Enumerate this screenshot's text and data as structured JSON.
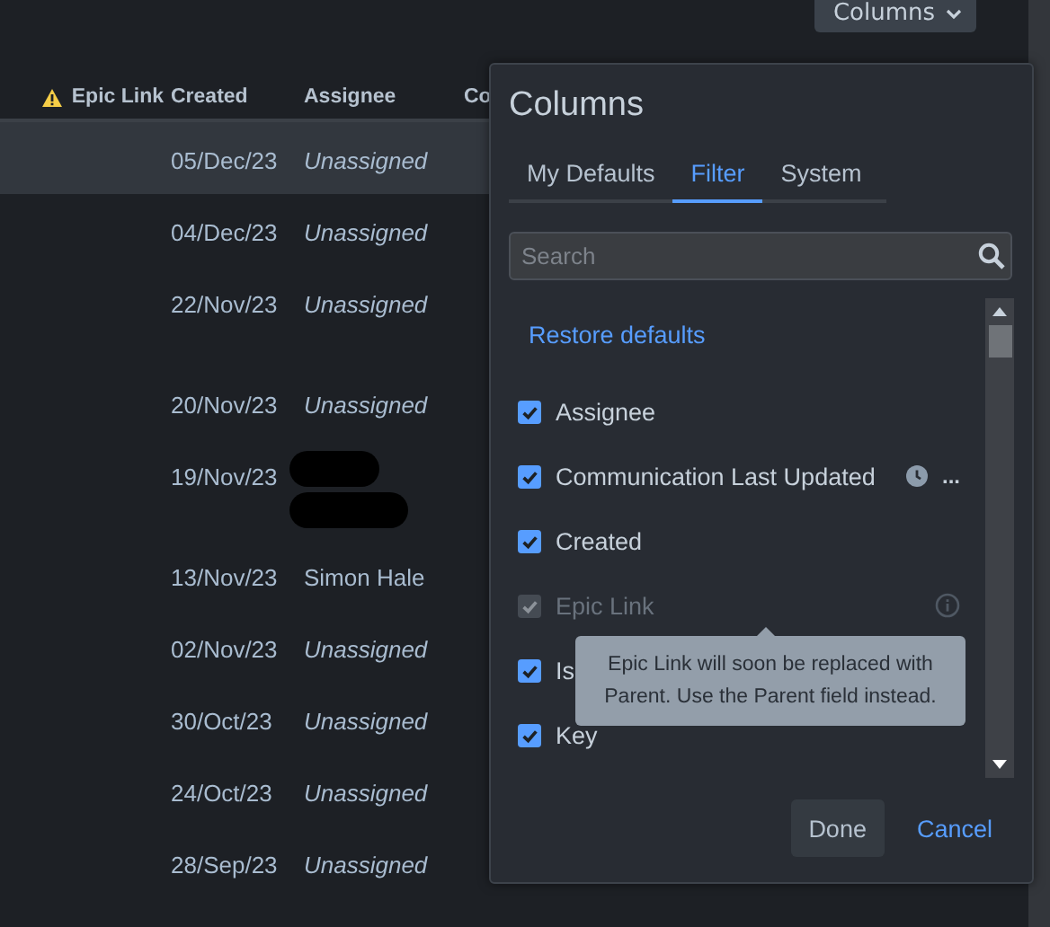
{
  "toolbar": {
    "columns_button": "Columns"
  },
  "table": {
    "columns": [
      {
        "label": "Epic Link",
        "warning": true
      },
      {
        "label": "Created"
      },
      {
        "label": "Assignee"
      },
      {
        "label": "Co"
      }
    ],
    "rows": [
      {
        "created": "05/Dec/23",
        "assignee": "Unassigned",
        "unassigned": true,
        "redacted": false,
        "tall": false,
        "selected": true
      },
      {
        "created": "04/Dec/23",
        "assignee": "Unassigned",
        "unassigned": true,
        "redacted": false,
        "tall": false,
        "selected": false
      },
      {
        "created": "22/Nov/23",
        "assignee": "Unassigned",
        "unassigned": true,
        "redacted": false,
        "tall": true,
        "selected": false
      },
      {
        "created": "20/Nov/23",
        "assignee": "Unassigned",
        "unassigned": true,
        "redacted": false,
        "tall": false,
        "selected": false
      },
      {
        "created": "19/Nov/23",
        "redacted": true,
        "tall": true,
        "selected": false
      },
      {
        "created": "13/Nov/23",
        "assignee": "Simon Hale",
        "unassigned": false,
        "redacted": false,
        "tall": false,
        "selected": false
      },
      {
        "created": "02/Nov/23",
        "assignee": "Unassigned",
        "unassigned": true,
        "redacted": false,
        "tall": false,
        "selected": false
      },
      {
        "created": "30/Oct/23",
        "assignee": "Unassigned",
        "unassigned": true,
        "redacted": false,
        "tall": false,
        "selected": false
      },
      {
        "created": "24/Oct/23",
        "assignee": "Unassigned",
        "unassigned": true,
        "redacted": false,
        "tall": false,
        "selected": false
      },
      {
        "created": "28/Sep/23",
        "assignee": "Unassigned",
        "unassigned": true,
        "redacted": false,
        "tall": false,
        "selected": false
      }
    ]
  },
  "columns_dialog": {
    "title": "Columns",
    "tabs": [
      {
        "label": "My Defaults",
        "selected": false
      },
      {
        "label": "Filter",
        "selected": true
      },
      {
        "label": "System",
        "selected": false
      }
    ],
    "search": {
      "placeholder": "Search"
    },
    "restore_link": "Restore defaults",
    "items": [
      {
        "kind": "plain",
        "label": "Assignee",
        "checked": true,
        "disabled": false
      },
      {
        "kind": "timestamp",
        "label": "Communication Last Updated",
        "checked": true,
        "disabled": false,
        "suffix": "..."
      },
      {
        "kind": "plain",
        "label": "Created",
        "checked": true,
        "disabled": false
      },
      {
        "kind": "info",
        "label": "Epic Link",
        "checked": true,
        "disabled": true
      },
      {
        "kind": "plain",
        "label": "Is",
        "checked": true,
        "disabled": false
      },
      {
        "kind": "plain",
        "label": "Key",
        "checked": true,
        "disabled": false
      }
    ],
    "tooltip": "Epic Link will soon be replaced with Parent. Use the Parent field instead.",
    "buttons": [
      {
        "kind": "primary",
        "label": "Done"
      },
      {
        "kind": "link",
        "label": "Cancel"
      }
    ]
  }
}
